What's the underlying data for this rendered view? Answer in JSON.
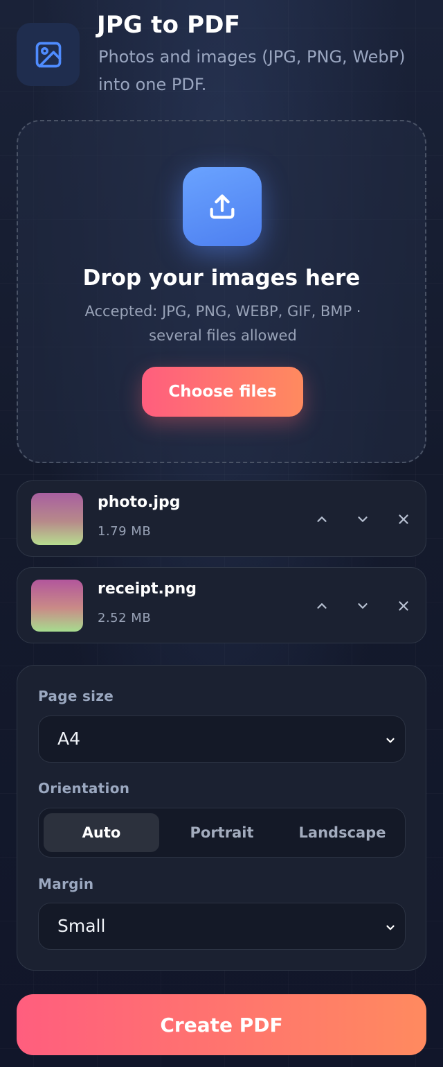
{
  "header": {
    "title": "JPG to PDF",
    "subtitle": "Photos and images (JPG, PNG, WebP) into one PDF.",
    "icon": "image-icon"
  },
  "dropzone": {
    "icon": "upload-icon",
    "title": "Drop your images here",
    "subtitle": "Accepted: JPG, PNG, WEBP, GIF, BMP · several files allowed",
    "button_label": "Choose files"
  },
  "files": [
    {
      "name": "photo.jpg",
      "size": "1.79 MB"
    },
    {
      "name": "receipt.png",
      "size": "2.52 MB"
    }
  ],
  "file_actions": [
    "chevron-up-icon",
    "chevron-down-icon",
    "close-icon"
  ],
  "settings": {
    "page_size": {
      "label": "Page size",
      "value": "A4"
    },
    "orientation": {
      "label": "Orientation",
      "options": [
        "Auto",
        "Portrait",
        "Landscape"
      ],
      "selected": "Auto"
    },
    "margin": {
      "label": "Margin",
      "value": "Small"
    }
  },
  "create_button": "Create PDF",
  "colors": {
    "accent_start": "#ff5e7e",
    "accent_end": "#ff8a5f",
    "upload_blue": "#5b8ff9",
    "icon_blue": "#4f8cff",
    "background": "#141a2c"
  }
}
